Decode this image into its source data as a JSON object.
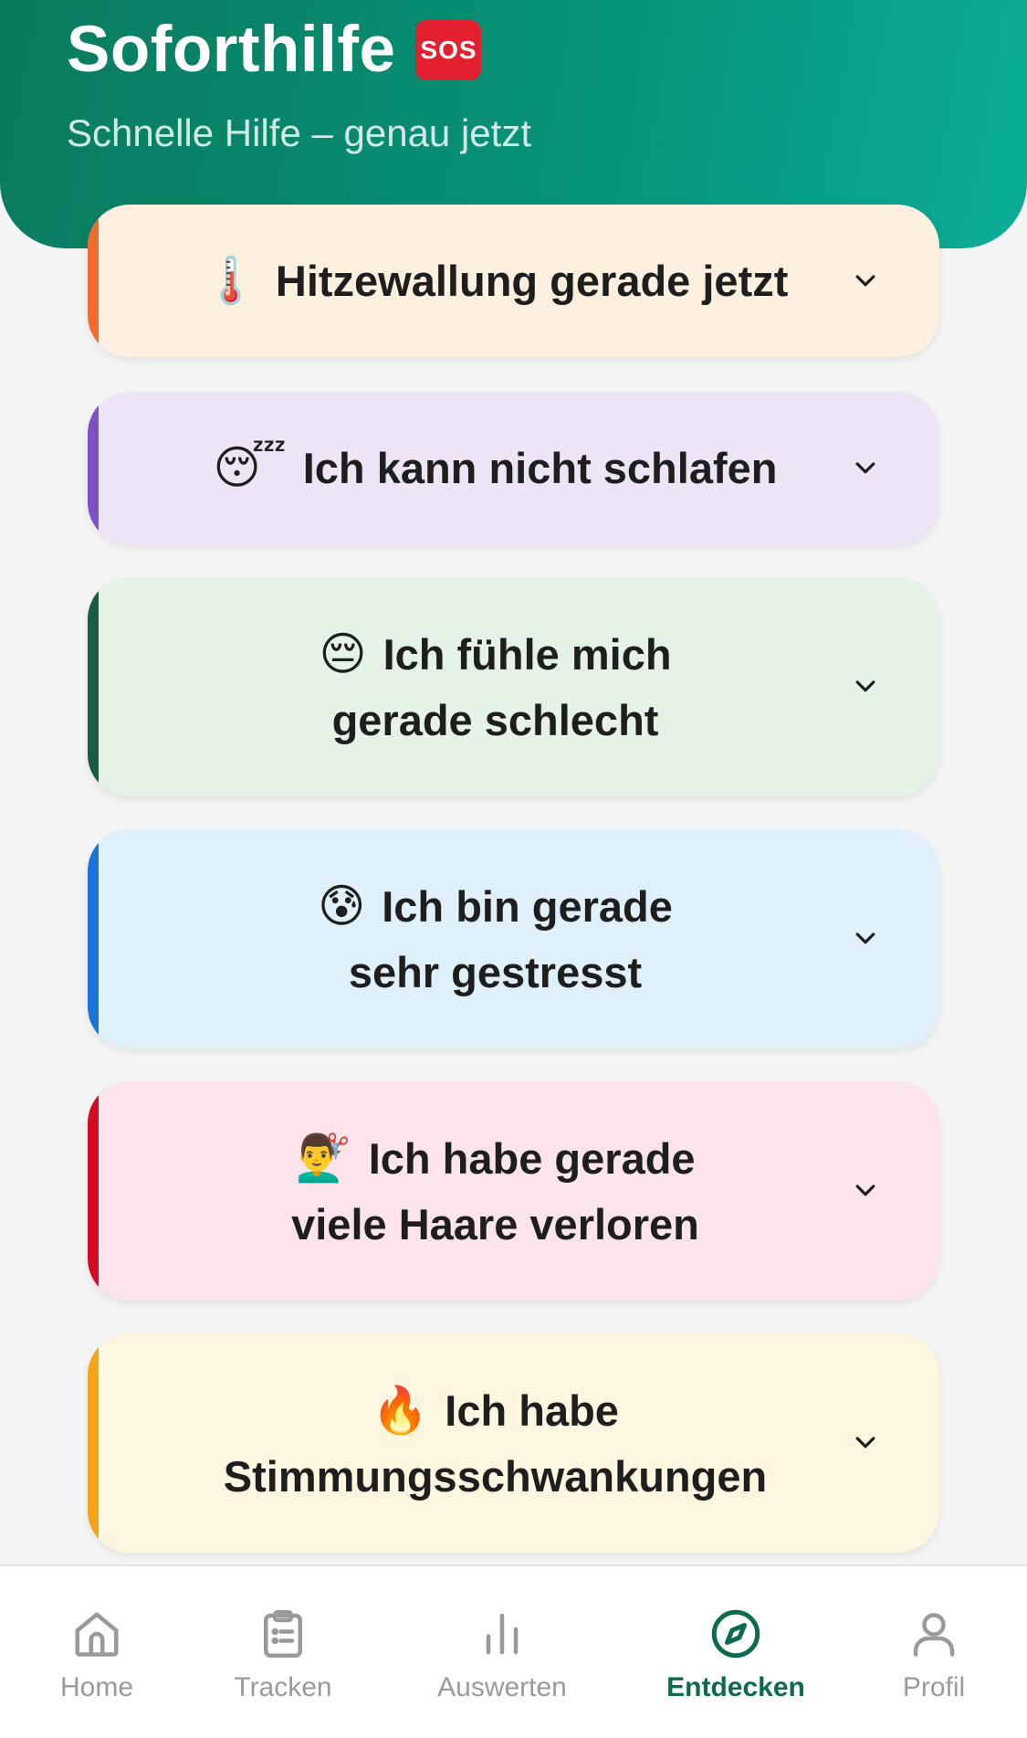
{
  "header": {
    "title": "Soforthilfe",
    "badge": "SOS",
    "subtitle": "Schnelle Hilfe – genau jetzt",
    "colors": {
      "start": "#0a7a5f",
      "end": "#0aad97"
    }
  },
  "cards": [
    {
      "emoji": "🌡️",
      "label": "Hitzewallung gerade jetzt",
      "bg": "#fef0de",
      "accent": "#f36b2c",
      "icon": "chevron-down-icon"
    },
    {
      "emoji": "😴",
      "label": "Ich kann nicht schlafen",
      "bg": "#ede5f6",
      "accent": "#7b52c2",
      "icon": "chevron-down-icon"
    },
    {
      "emoji": "😔",
      "label": "Ich fühle mich\ngerade schlecht",
      "bg": "#e4f3e6",
      "accent": "#1a5c3c",
      "icon": "chevron-down-icon"
    },
    {
      "emoji": "😰",
      "label": "Ich bin gerade\nsehr gestresst",
      "bg": "#dff0fb",
      "accent": "#1a73d9",
      "icon": "chevron-down-icon"
    },
    {
      "emoji": "💇‍♂️",
      "label": "Ich habe gerade\nviele Haare verloren",
      "bg": "#fde3ea",
      "accent": "#d20c23",
      "icon": "chevron-down-icon"
    },
    {
      "emoji": "🔥",
      "label": "Ich habe\nStimmungsschwankungen",
      "bg": "#fef6df",
      "accent": "#f5a417",
      "icon": "chevron-down-icon"
    }
  ],
  "tabbar": {
    "items": [
      {
        "label": "Home",
        "icon": "home-icon",
        "active": false
      },
      {
        "label": "Tracken",
        "icon": "clipboard-icon",
        "active": false
      },
      {
        "label": "Auswerten",
        "icon": "bar-chart-icon",
        "active": false
      },
      {
        "label": "Entdecken",
        "icon": "compass-icon",
        "active": true
      },
      {
        "label": "Profil",
        "icon": "user-icon",
        "active": false
      }
    ],
    "colors": {
      "active": "#0b6b4c",
      "inactive": "#9a9a9a"
    }
  }
}
